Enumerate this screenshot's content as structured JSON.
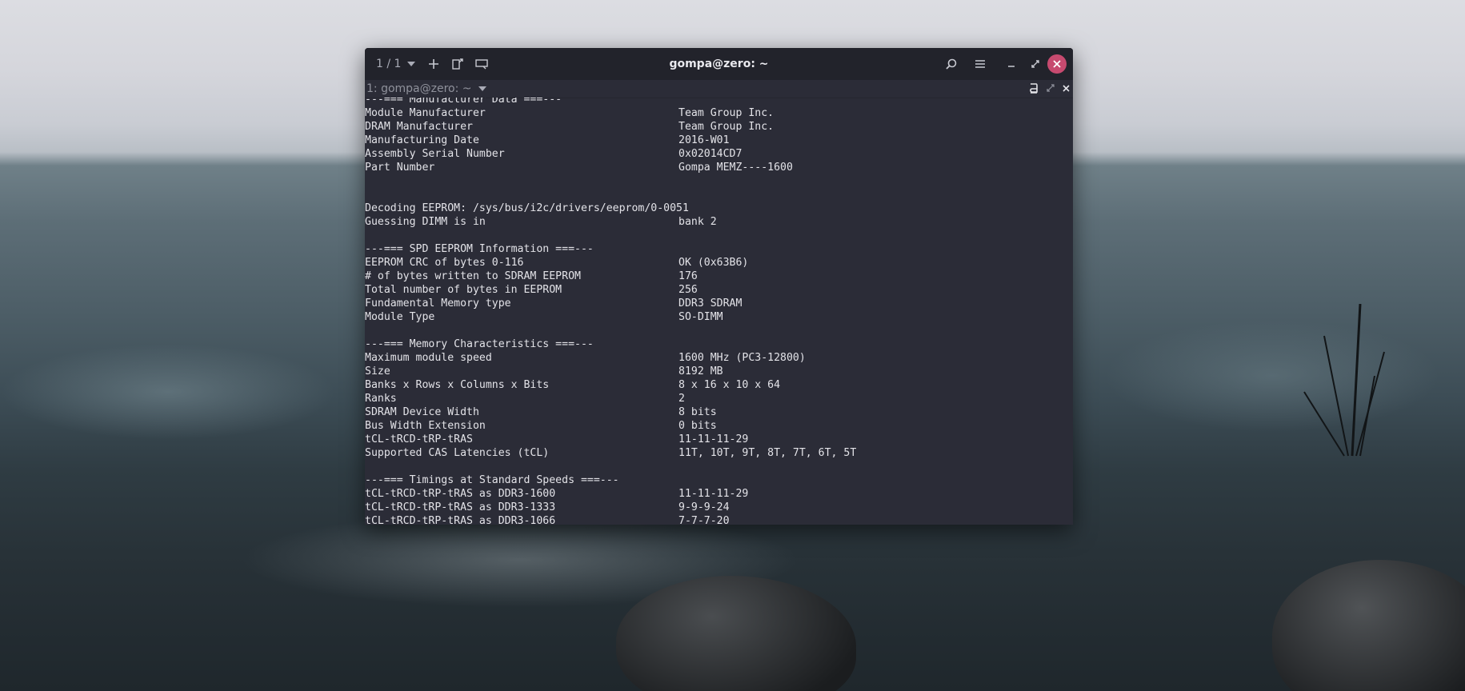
{
  "window": {
    "title": "gompa@zero: ~",
    "session_counter": "1 / 1",
    "tab_label": "1: gompa@zero: ~"
  },
  "icons": {
    "dropdown": "chevron-down-icon",
    "add": "plus-icon",
    "split": "split-terminal-icon",
    "sessions": "session-icon",
    "search": "search-icon",
    "menu": "hamburger-menu-icon",
    "minimize": "minimize-icon",
    "maximize": "maximize-icon",
    "close": "close-icon"
  },
  "colors": {
    "terminal_bg": "#2b2c37",
    "headerbar_bg": "#22232b",
    "close_button": "#c74a6f",
    "text": "#e3e3e8"
  },
  "terminal_lines": [
    {
      "text": "---=== Manufacturer Data ===---"
    },
    {
      "key": "Module Manufacturer",
      "value": "Team Group Inc."
    },
    {
      "key": "DRAM Manufacturer",
      "value": "Team Group Inc."
    },
    {
      "key": "Manufacturing Date",
      "value": "2016-W01"
    },
    {
      "key": "Assembly Serial Number",
      "value": "0x02014CD7"
    },
    {
      "key": "Part Number",
      "value": "Gompa MEMZ----1600"
    },
    {
      "text": ""
    },
    {
      "text": ""
    },
    {
      "text": "Decoding EEPROM: /sys/bus/i2c/drivers/eeprom/0-0051"
    },
    {
      "key": "Guessing DIMM is in",
      "value": "bank 2"
    },
    {
      "text": ""
    },
    {
      "text": "---=== SPD EEPROM Information ===---"
    },
    {
      "key": "EEPROM CRC of bytes 0-116",
      "value": "OK (0x63B6)"
    },
    {
      "key": "# of bytes written to SDRAM EEPROM",
      "value": "176"
    },
    {
      "key": "Total number of bytes in EEPROM",
      "value": "256"
    },
    {
      "key": "Fundamental Memory type",
      "value": "DDR3 SDRAM"
    },
    {
      "key": "Module Type",
      "value": "SO-DIMM"
    },
    {
      "text": ""
    },
    {
      "text": "---=== Memory Characteristics ===---"
    },
    {
      "key": "Maximum module speed",
      "value": "1600 MHz (PC3-12800)"
    },
    {
      "key": "Size",
      "value": "8192 MB"
    },
    {
      "key": "Banks x Rows x Columns x Bits",
      "value": "8 x 16 x 10 x 64"
    },
    {
      "key": "Ranks",
      "value": "2"
    },
    {
      "key": "SDRAM Device Width",
      "value": "8 bits"
    },
    {
      "key": "Bus Width Extension",
      "value": "0 bits"
    },
    {
      "key": "tCL-tRCD-tRP-tRAS",
      "value": "11-11-11-29"
    },
    {
      "key": "Supported CAS Latencies (tCL)",
      "value": "11T, 10T, 9T, 8T, 7T, 6T, 5T"
    },
    {
      "text": ""
    },
    {
      "text": "---=== Timings at Standard Speeds ===---"
    },
    {
      "key": "tCL-tRCD-tRP-tRAS as DDR3-1600",
      "value": "11-11-11-29"
    },
    {
      "key": "tCL-tRCD-tRP-tRAS as DDR3-1333",
      "value": "9-9-9-24"
    },
    {
      "key": "tCL-tRCD-tRP-tRAS as DDR3-1066",
      "value": "7-7-7-20"
    }
  ]
}
